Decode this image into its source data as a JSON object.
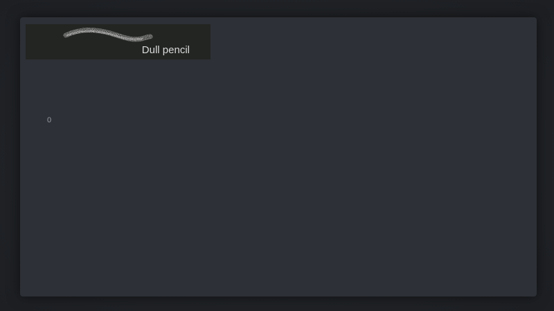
{
  "brush": {
    "name": "Dull pencil",
    "icon": "brush-stroke-icon"
  },
  "slot": {
    "value": "0"
  },
  "colors": {
    "background": "#1e2024",
    "panel": "#2d3036",
    "card": "#232522",
    "stroke": "#e6e6e6"
  }
}
